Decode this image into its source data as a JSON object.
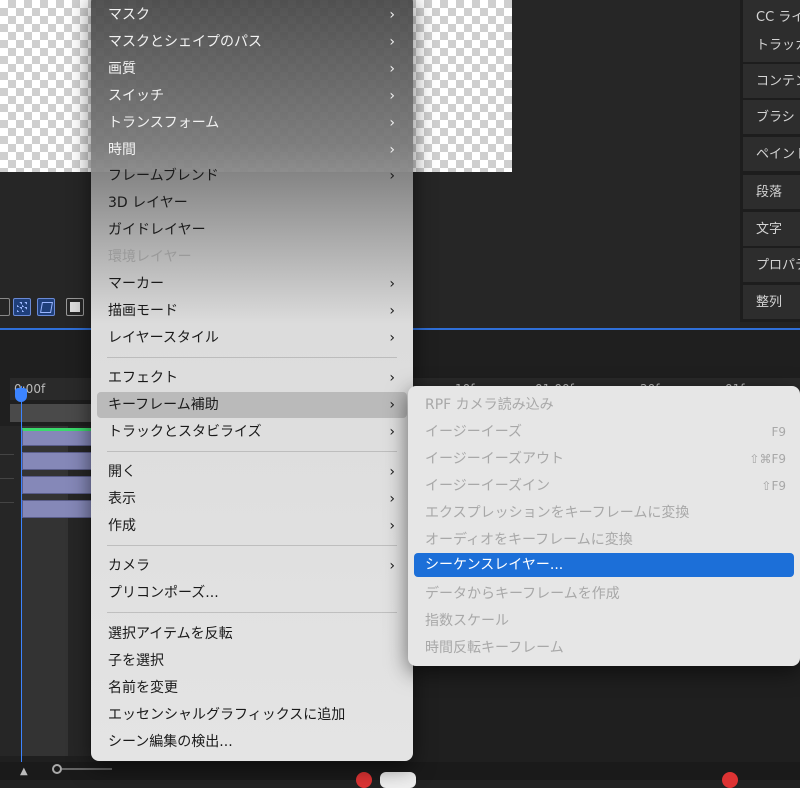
{
  "right_panels": [
    "CC ライブラリ",
    "トラッカー",
    "コンテンツ",
    "ブラシ",
    "ペイント",
    "段落",
    "文字",
    "プロパティ",
    "整列"
  ],
  "timeline": {
    "time_labels": [
      "0:00f",
      "10f",
      "01:00f",
      "20f",
      "01f"
    ]
  },
  "main_menu": {
    "items": [
      {
        "label": "マスク",
        "submenu": true,
        "state": "light"
      },
      {
        "label": "マスクとシェイプのパス",
        "submenu": true,
        "state": "light"
      },
      {
        "label": "画質",
        "submenu": true,
        "state": "light"
      },
      {
        "label": "スイッチ",
        "submenu": true,
        "state": "light"
      },
      {
        "label": "トランスフォーム",
        "submenu": true,
        "state": "light"
      },
      {
        "label": "時間",
        "submenu": true,
        "state": "light"
      },
      {
        "label": "フレームブレンド",
        "submenu": true,
        "state": "normal"
      },
      {
        "label": "3D レイヤー",
        "submenu": false,
        "state": "normal"
      },
      {
        "label": "ガイドレイヤー",
        "submenu": false,
        "state": "normal"
      },
      {
        "label": "環境レイヤー",
        "submenu": false,
        "state": "disabled"
      },
      {
        "label": "マーカー",
        "submenu": true,
        "state": "normal"
      },
      {
        "label": "描画モード",
        "submenu": true,
        "state": "normal"
      },
      {
        "label": "レイヤースタイル",
        "submenu": true,
        "state": "normal"
      },
      {
        "label": "エフェクト",
        "submenu": true,
        "state": "normal"
      },
      {
        "label": "キーフレーム補助",
        "submenu": true,
        "state": "hover"
      },
      {
        "label": "トラックとスタビライズ",
        "submenu": true,
        "state": "normal"
      },
      {
        "label": "開く",
        "submenu": true,
        "state": "normal"
      },
      {
        "label": "表示",
        "submenu": true,
        "state": "normal"
      },
      {
        "label": "作成",
        "submenu": true,
        "state": "normal"
      },
      {
        "label": "カメラ",
        "submenu": true,
        "state": "normal"
      },
      {
        "label": "プリコンポーズ...",
        "submenu": false,
        "state": "normal"
      },
      {
        "label": "選択アイテムを反転",
        "submenu": false,
        "state": "normal"
      },
      {
        "label": "子を選択",
        "submenu": false,
        "state": "normal"
      },
      {
        "label": "名前を変更",
        "submenu": false,
        "state": "normal"
      },
      {
        "label": "エッセンシャルグラフィックスに追加",
        "submenu": false,
        "state": "normal"
      },
      {
        "label": "シーン編集の検出...",
        "submenu": false,
        "state": "normal"
      }
    ]
  },
  "sub_menu": {
    "items": [
      {
        "label": "RPF カメラ読み込み",
        "shortcut": "",
        "state": "disabled"
      },
      {
        "label": "イージーイーズ",
        "shortcut": "F9",
        "state": "disabled"
      },
      {
        "label": "イージーイーズアウト",
        "shortcut": "⇧⌘F9",
        "state": "disabled"
      },
      {
        "label": "イージーイーズイン",
        "shortcut": "⇧F9",
        "state": "disabled"
      },
      {
        "label": "エクスプレッションをキーフレームに変換",
        "shortcut": "",
        "state": "disabled"
      },
      {
        "label": "オーディオをキーフレームに変換",
        "shortcut": "",
        "state": "disabled"
      },
      {
        "label": "シーケンスレイヤー...",
        "shortcut": "",
        "state": "active"
      },
      {
        "label": "データからキーフレームを作成",
        "shortcut": "",
        "state": "disabled"
      },
      {
        "label": "指数スケール",
        "shortcut": "",
        "state": "disabled"
      },
      {
        "label": "時間反転キーフレーム",
        "shortcut": "",
        "state": "disabled"
      }
    ]
  },
  "icons": {
    "submenu_indicator": "chevron-right-icon"
  },
  "colors": {
    "accent": "#1c6fd8",
    "playhead": "#3c84ff",
    "clip": "#8588b8",
    "clip_top": "#3ad96b"
  }
}
